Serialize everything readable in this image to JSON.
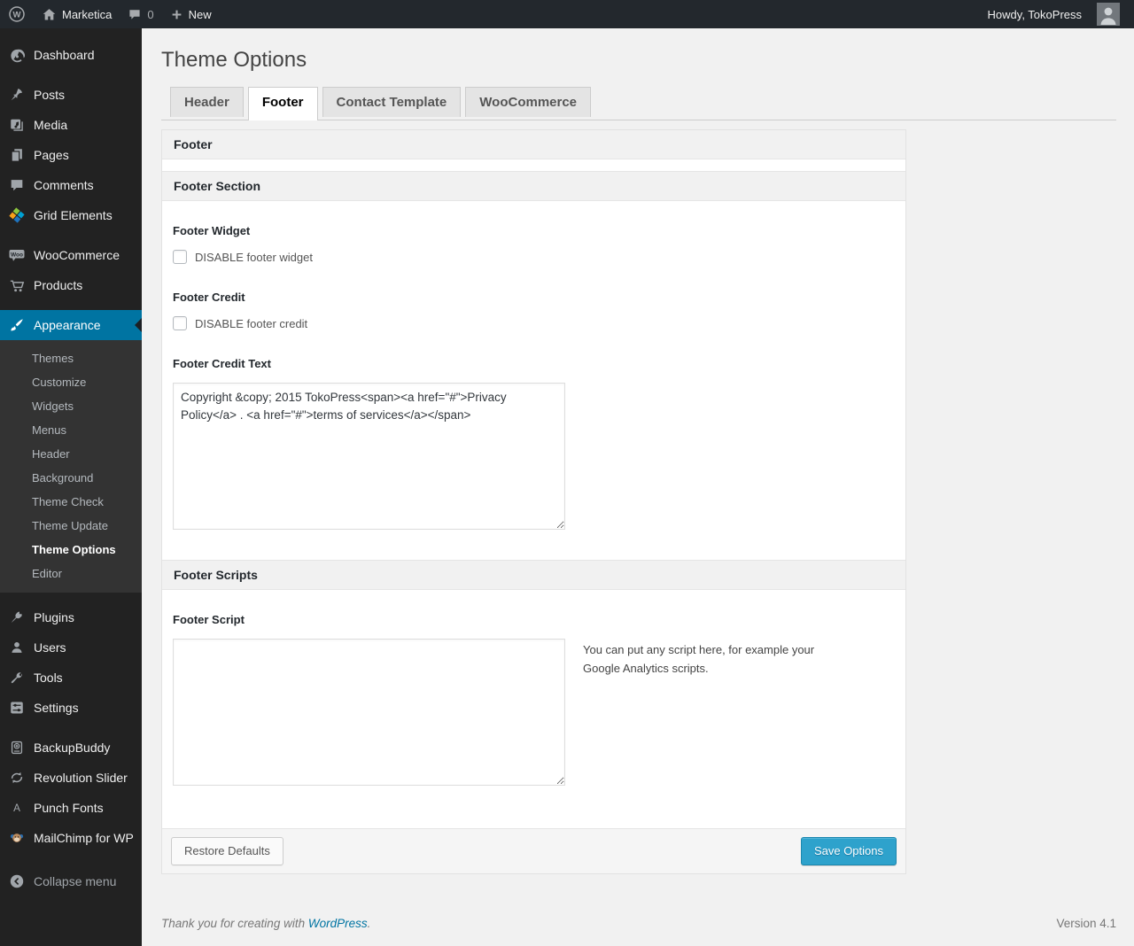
{
  "admin_bar": {
    "site_name": "Marketica",
    "comment_count": "0",
    "new_label": "New",
    "howdy": "Howdy, TokoPress"
  },
  "sidebar": {
    "items": [
      {
        "label": "Dashboard",
        "icon": "dashboard-icon"
      },
      {
        "label": "Posts",
        "icon": "posts-icon"
      },
      {
        "label": "Media",
        "icon": "media-icon"
      },
      {
        "label": "Pages",
        "icon": "pages-icon"
      },
      {
        "label": "Comments",
        "icon": "comments-icon"
      },
      {
        "label": "Grid Elements",
        "icon": "grid-elements-icon"
      },
      {
        "label": "WooCommerce",
        "icon": "woocommerce-icon"
      },
      {
        "label": "Products",
        "icon": "products-icon"
      },
      {
        "label": "Appearance",
        "icon": "appearance-icon",
        "active": true
      },
      {
        "label": "Plugins",
        "icon": "plugins-icon"
      },
      {
        "label": "Users",
        "icon": "users-icon"
      },
      {
        "label": "Tools",
        "icon": "tools-icon"
      },
      {
        "label": "Settings",
        "icon": "settings-icon"
      },
      {
        "label": "BackupBuddy",
        "icon": "backupbuddy-icon"
      },
      {
        "label": "Revolution Slider",
        "icon": "revolution-slider-icon"
      },
      {
        "label": "Punch Fonts",
        "icon": "punch-fonts-icon"
      },
      {
        "label": "MailChimp for WP",
        "icon": "mailchimp-icon"
      }
    ],
    "appearance_submenu": [
      "Themes",
      "Customize",
      "Widgets",
      "Menus",
      "Header",
      "Background",
      "Theme Check",
      "Theme Update",
      "Theme Options",
      "Editor"
    ],
    "current_submenu_item": "Theme Options",
    "collapse_label": "Collapse menu"
  },
  "page": {
    "title": "Theme Options",
    "tabs": [
      {
        "label": "Header",
        "active": false
      },
      {
        "label": "Footer",
        "active": true
      },
      {
        "label": "Contact Template",
        "active": false
      },
      {
        "label": "WooCommerce",
        "active": false
      }
    ]
  },
  "panel": {
    "group_title": "Footer",
    "section_title": "Footer Section",
    "fields": {
      "footer_widget": {
        "label": "Footer Widget",
        "checkbox_label": "DISABLE footer widget",
        "checked": false
      },
      "footer_credit": {
        "label": "Footer Credit",
        "checkbox_label": "DISABLE footer credit",
        "checked": false
      },
      "footer_credit_text": {
        "label": "Footer Credit Text",
        "value": "Copyright &copy; 2015 TokoPress<span><a href=\"#\">Privacy Policy</a> . <a href=\"#\">terms of services</a></span>"
      }
    },
    "scripts_section_title": "Footer Scripts",
    "footer_script": {
      "label": "Footer Script",
      "value": "",
      "description": "You can put any script here, for example your Google Analytics scripts."
    },
    "buttons": {
      "restore": "Restore Defaults",
      "save": "Save Options"
    }
  },
  "page_footer": {
    "thanks_prefix": "Thank you for creating with ",
    "thanks_link": "WordPress",
    "thanks_suffix": ".",
    "version": "Version 4.1"
  },
  "colors": {
    "accent": "#0074a2",
    "button_primary": "#2ea2cc",
    "admin_bar_bg": "#23282d",
    "menu_bg": "#222222",
    "submenu_bg": "#333333",
    "page_bg": "#f1f1f1"
  }
}
